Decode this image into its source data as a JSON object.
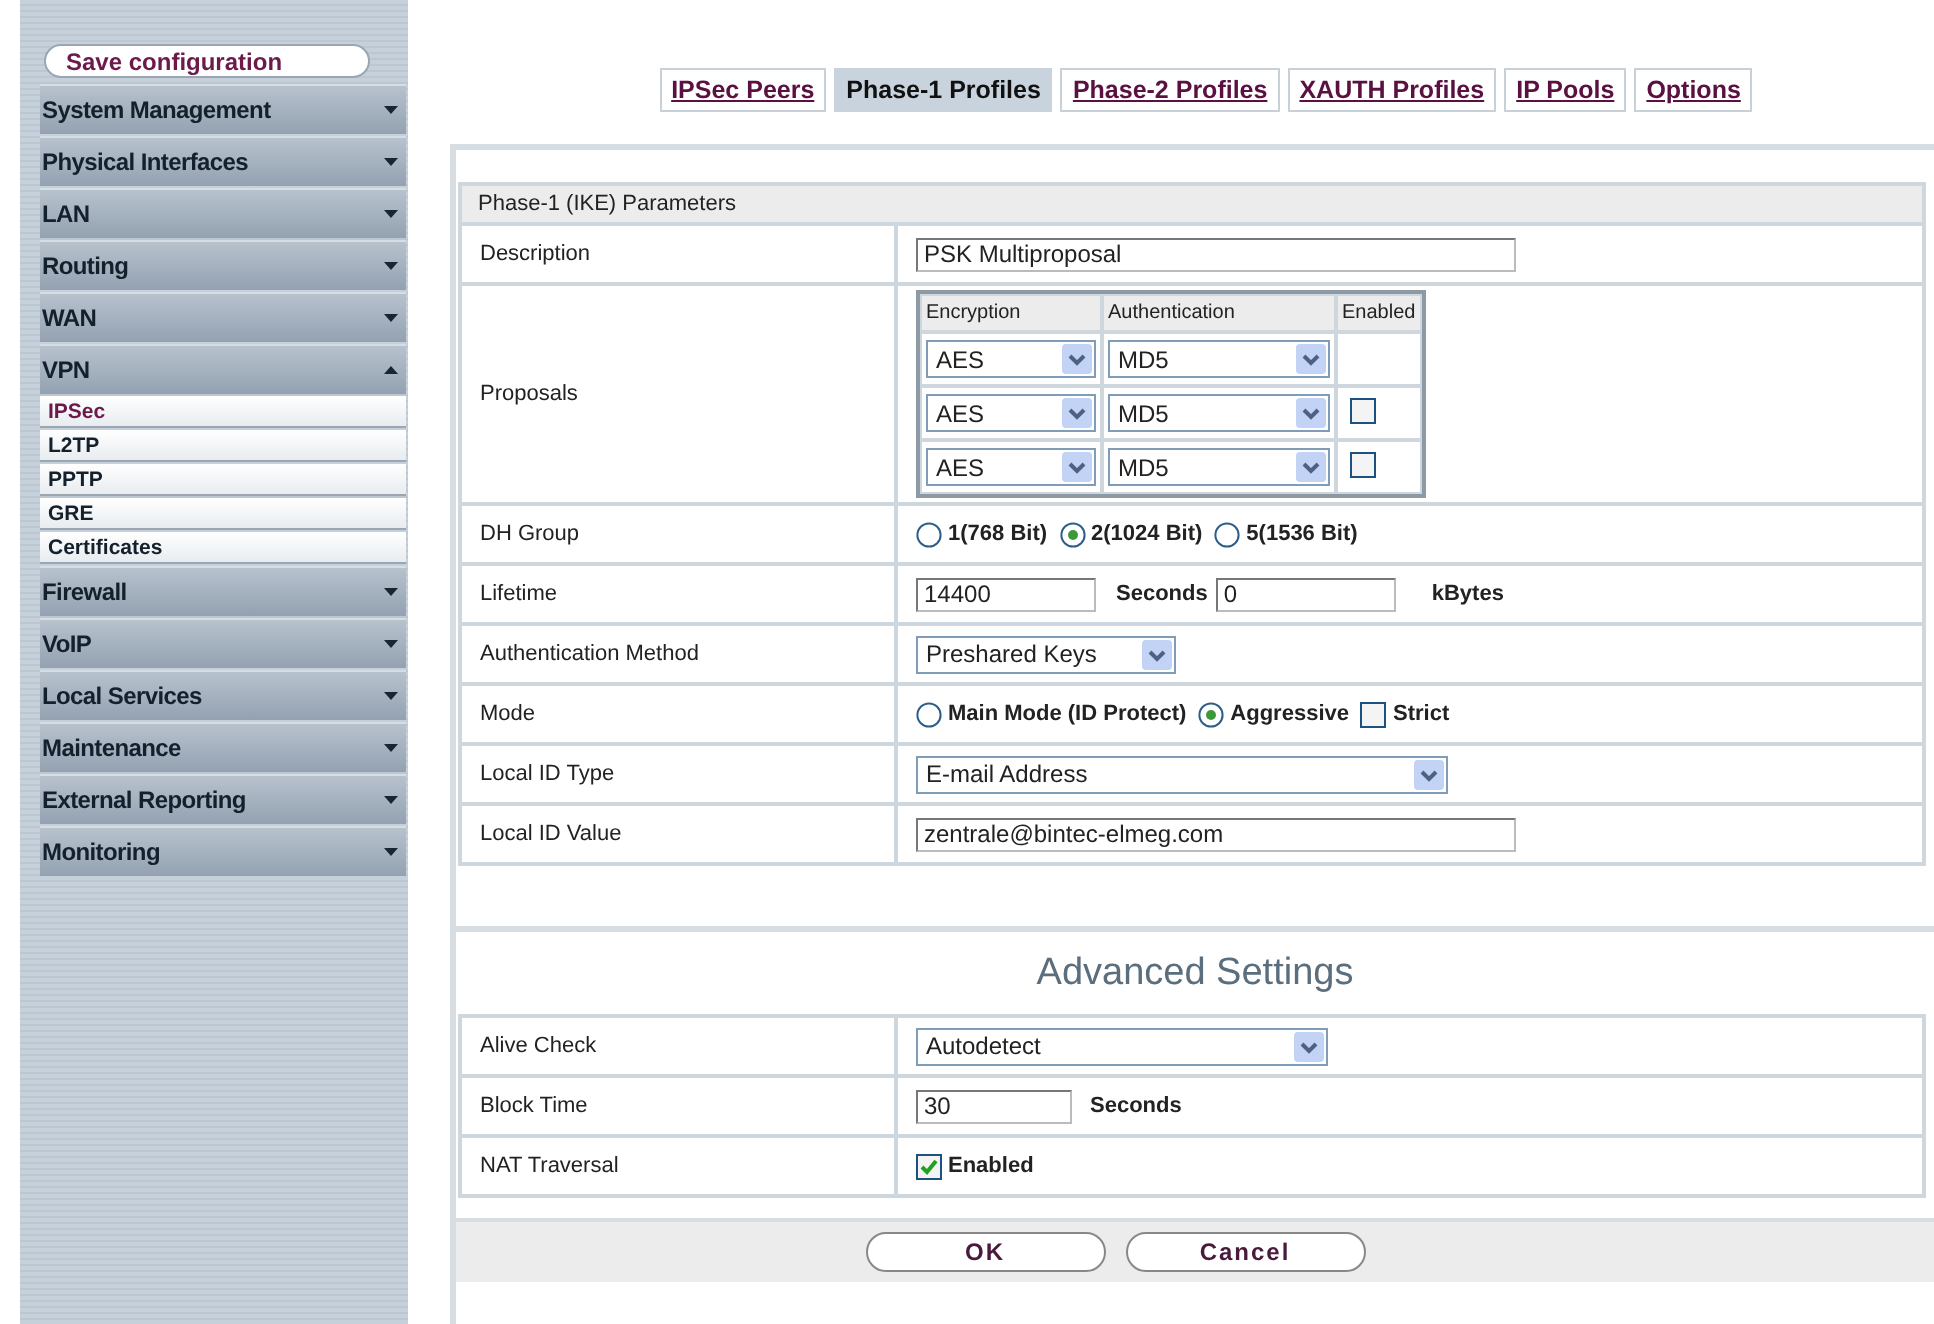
{
  "sidebar": {
    "save_button": "Save configuration",
    "items": [
      {
        "label": "System Management",
        "expanded": false
      },
      {
        "label": "Physical Interfaces",
        "expanded": false
      },
      {
        "label": "LAN",
        "expanded": false
      },
      {
        "label": "Routing",
        "expanded": false
      },
      {
        "label": "WAN",
        "expanded": false
      },
      {
        "label": "VPN",
        "expanded": true,
        "children": [
          {
            "label": "IPSec",
            "selected": true
          },
          {
            "label": "L2TP",
            "selected": false
          },
          {
            "label": "PPTP",
            "selected": false
          },
          {
            "label": "GRE",
            "selected": false
          },
          {
            "label": "Certificates",
            "selected": false
          }
        ]
      },
      {
        "label": "Firewall",
        "expanded": false
      },
      {
        "label": "VoIP",
        "expanded": false
      },
      {
        "label": "Local Services",
        "expanded": false
      },
      {
        "label": "Maintenance",
        "expanded": false
      },
      {
        "label": "External Reporting",
        "expanded": false
      },
      {
        "label": "Monitoring",
        "expanded": false
      }
    ]
  },
  "tabs": [
    {
      "label": "IPSec Peers",
      "selected": false
    },
    {
      "label": "Phase-1 Profiles",
      "selected": true
    },
    {
      "label": "Phase-2 Profiles",
      "selected": false
    },
    {
      "label": "XAUTH Profiles",
      "selected": false
    },
    {
      "label": "IP Pools",
      "selected": false
    },
    {
      "label": "Options",
      "selected": false
    }
  ],
  "parameters": {
    "title": "Phase-1 (IKE) Parameters",
    "rows": [
      {
        "kind": "text",
        "label": "Description",
        "value": "PSK Multiproposal"
      },
      {
        "kind": "proposals",
        "label": "Proposals",
        "headers": [
          "Encryption",
          "Authentication",
          "Enabled"
        ],
        "rows": [
          {
            "encryption": "AES",
            "authentication": "MD5"
          },
          {
            "encryption": "AES",
            "authentication": "MD5",
            "enabled": false
          },
          {
            "encryption": "AES",
            "authentication": "MD5",
            "enabled": false
          }
        ]
      },
      {
        "kind": "options",
        "label": "DH Group",
        "options": [
          {
            "kind": "radio",
            "label": "1(768 Bit)",
            "selected": false
          },
          {
            "kind": "radio",
            "label": "2(1024 Bit)",
            "selected": true
          },
          {
            "kind": "radio",
            "label": "5(1536 Bit)",
            "selected": false
          }
        ]
      },
      {
        "kind": "lifetime",
        "label": "Lifetime",
        "value": "14400",
        "unit": "Seconds",
        "value2": "0",
        "unit2": "kBytes"
      },
      {
        "kind": "select",
        "label": "Authentication Method",
        "value": "Preshared Keys"
      },
      {
        "kind": "options",
        "label": "Mode",
        "options": [
          {
            "kind": "radio",
            "label": "Main Mode (ID Protect)",
            "selected": false
          },
          {
            "kind": "radio",
            "label": "Aggressive",
            "selected": true
          },
          {
            "kind": "checkbox",
            "label": "Strict",
            "checked": false
          }
        ]
      },
      {
        "kind": "select",
        "label": "Local ID Type",
        "value": "E-mail Address"
      },
      {
        "kind": "text",
        "label": "Local ID Value",
        "value": "zentrale@bintec-elmeg.com"
      }
    ]
  },
  "advanced": {
    "title": "Advanced Settings",
    "rows": [
      {
        "kind": "select",
        "label": "Alive Check",
        "value": "Autodetect"
      },
      {
        "kind": "number",
        "label": "Block Time",
        "value": "30",
        "unit": "Seconds"
      },
      {
        "kind": "options",
        "label": "NAT Traversal",
        "options": [
          {
            "kind": "checkbox",
            "label": "Enabled",
            "checked": true
          }
        ]
      }
    ]
  },
  "buttons": [
    "OK",
    "Cancel"
  ]
}
